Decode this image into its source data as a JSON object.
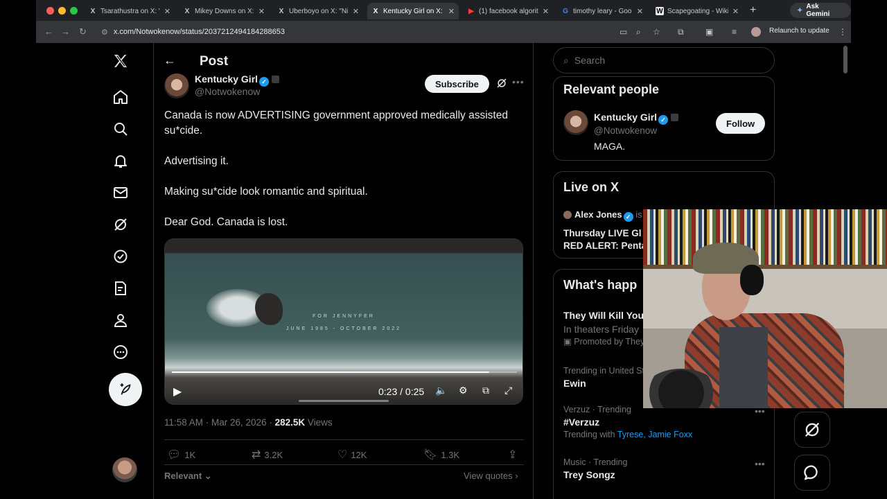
{
  "browser": {
    "tabs": [
      {
        "title": "Tsarathustra on X: \"",
        "favicon": "X",
        "active": false
      },
      {
        "title": "Mikey Downs on X:",
        "favicon": "X",
        "active": false
      },
      {
        "title": "Uberboyo on X: \"Ni",
        "favicon": "X",
        "active": false
      },
      {
        "title": "Kentucky Girl on X:",
        "favicon": "X",
        "active": true
      },
      {
        "title": "(1) facebook algorit",
        "favicon": "▶",
        "active": false
      },
      {
        "title": "timothy leary - Goo",
        "favicon": "G",
        "active": false
      },
      {
        "title": "Scapegoating - Wiki",
        "favicon": "W",
        "active": false
      }
    ],
    "new_tab": "+",
    "gemini_label": "Ask Gemini",
    "url": "x.com/Notwokenow/status/2037212494184288653",
    "relaunch_label": "Relaunch to update"
  },
  "post": {
    "header_title": "Post",
    "author_name": "Kentucky Girl",
    "author_handle": "@Notwokenow",
    "subscribe_label": "Subscribe",
    "paragraphs": [
      "Canada is now ADVERTISING government approved medically assisted su*cide.",
      "Advertising it.",
      "Making su*cide look romantic and spiritual.",
      "Dear God. Canada is lost."
    ],
    "video": {
      "line1": "FOR JENNYFER",
      "line2": "JUNE 1985 - OCTOBER 2022",
      "time": "0:23 / 0:25",
      "progress": 0.92
    },
    "timestamp": "11:58 AM · Mar 26, 2026 · ",
    "views_count": "282.5K",
    "views_label": " Views",
    "actions": {
      "replies": "1K",
      "reposts": "3.2K",
      "likes": "12K",
      "bookmarks": "1.3K"
    },
    "sort_label": "Relevant",
    "view_quotes": "View quotes"
  },
  "sidebar": {
    "search_placeholder": "Search",
    "relevant_people": {
      "title": "Relevant people",
      "name": "Kentucky Girl",
      "handle": "@Notwokenow",
      "bio": "MAGA.",
      "follow_label": "Follow"
    },
    "live": {
      "title": "Live on X",
      "host": "Alex Jones",
      "host_suffix": "is",
      "stream_title": "Thursday LIVE Gl",
      "stream_title2": "RED ALERT: Penta"
    },
    "whats_happening": {
      "title": "What's happ",
      "items": [
        {
          "category": "",
          "name": "They Will Kill You",
          "sub": "In theaters Friday",
          "promo": "Promoted by They"
        },
        {
          "category": "Trending in United St",
          "name": "Ewin"
        },
        {
          "category": "Verzuz · Trending",
          "name": "#Verzuz",
          "sub_prefix": "Trending with ",
          "links": "Tyrese, Jamie Foxx"
        },
        {
          "category": "Music · Trending",
          "name": "Trey Songz"
        }
      ]
    }
  },
  "colors": {
    "accent": "#1d9bf0",
    "background": "#000000",
    "text_primary": "#e7e9ea",
    "text_secondary": "#71767b",
    "border": "#2f3336"
  }
}
